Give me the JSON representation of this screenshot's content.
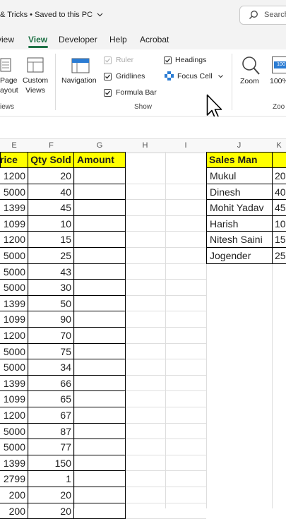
{
  "titlebar": {
    "title": "& Tricks • Saved to this PC",
    "search_placeholder": "Search"
  },
  "tabs": [
    {
      "label": "view"
    },
    {
      "label": "View"
    },
    {
      "label": "Developer"
    },
    {
      "label": "Help"
    },
    {
      "label": "Acrobat"
    }
  ],
  "ribbon": {
    "page_layout": [
      "Page",
      "ayout"
    ],
    "custom_views": [
      "Custom",
      "Views"
    ],
    "navigation": "Navigation",
    "ruler": "Ruler",
    "gridlines": "Gridlines",
    "formula_bar": "Formula Bar",
    "headings": "Headings",
    "focus_cell": "Focus Cell",
    "zoom": "Zoom",
    "zoom100": "100%",
    "zoom100_icon": "100",
    "group_views": "iews",
    "group_show": "Show",
    "group_zoom": "Zoo"
  },
  "columns": [
    "E",
    "F",
    "G",
    "H",
    "I",
    "J",
    "K"
  ],
  "headers": {
    "e": "rice",
    "f": "Qty Sold",
    "g": "Amount",
    "j": "Sales Man"
  },
  "rows": [
    {
      "price": "1200",
      "qty": "20"
    },
    {
      "price": "5000",
      "qty": "40"
    },
    {
      "price": "1399",
      "qty": "45"
    },
    {
      "price": "1099",
      "qty": "10"
    },
    {
      "price": "1200",
      "qty": "15"
    },
    {
      "price": "5000",
      "qty": "25"
    },
    {
      "price": "5000",
      "qty": "43"
    },
    {
      "price": "5000",
      "qty": "30"
    },
    {
      "price": "1399",
      "qty": "50"
    },
    {
      "price": "1099",
      "qty": "90"
    },
    {
      "price": "1200",
      "qty": "70"
    },
    {
      "price": "5000",
      "qty": "75"
    },
    {
      "price": "5000",
      "qty": "34"
    },
    {
      "price": "1399",
      "qty": "66"
    },
    {
      "price": "1099",
      "qty": "65"
    },
    {
      "price": "1200",
      "qty": "67"
    },
    {
      "price": "5000",
      "qty": "87"
    },
    {
      "price": "5000",
      "qty": "77"
    },
    {
      "price": "1399",
      "qty": "150"
    },
    {
      "price": "2799",
      "qty": "1"
    },
    {
      "price": "200",
      "qty": "20"
    },
    {
      "price": "200",
      "qty": "20"
    }
  ],
  "salesmen": [
    {
      "name": "Mukul",
      "k": "20"
    },
    {
      "name": "Dinesh",
      "k": "40"
    },
    {
      "name": "Mohit Yadav",
      "k": "45"
    },
    {
      "name": "Harish",
      "k": "10"
    },
    {
      "name": "Nitesh Saini",
      "k": "15"
    },
    {
      "name": "Jogender",
      "k": "25"
    }
  ],
  "colors": {
    "header_yellow": "#ffff00",
    "accent_green": "#1e7145",
    "focus_blue": "#2b7cd3"
  }
}
